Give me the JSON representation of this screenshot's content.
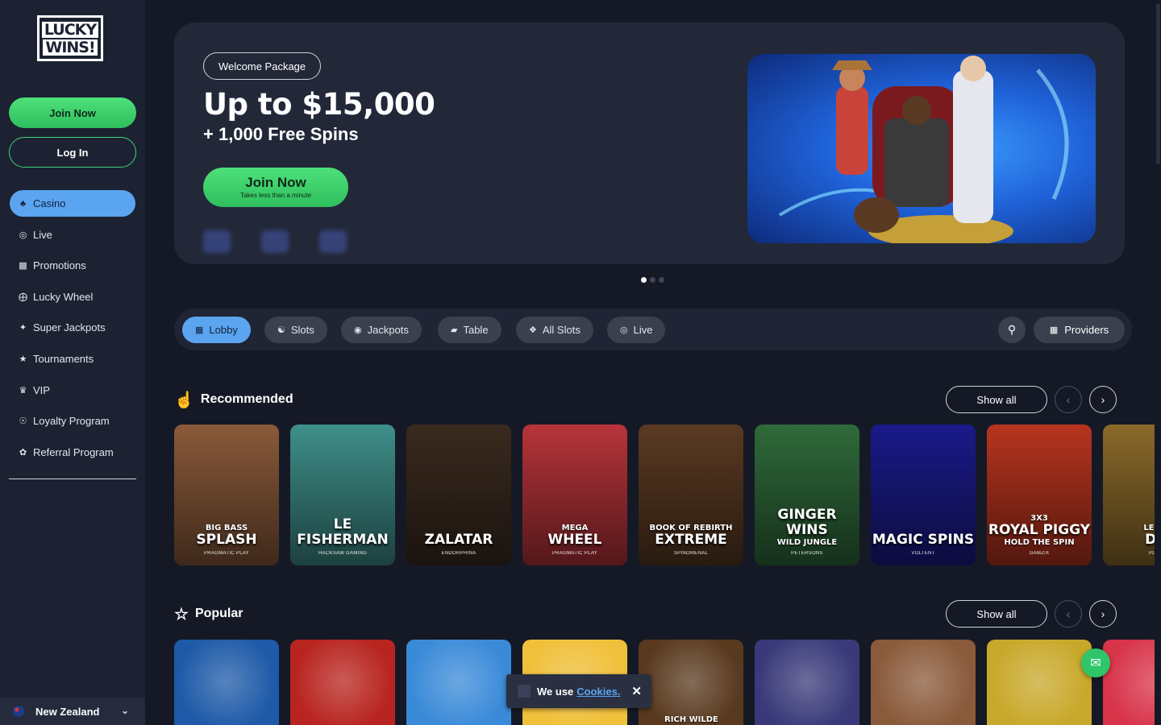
{
  "brand": {
    "line1": "LUCKY",
    "line2": "WINS!"
  },
  "sidebar": {
    "join_label": "Join Now",
    "login_label": "Log In",
    "items": [
      {
        "label": "Casino",
        "icon": "casino-icon"
      },
      {
        "label": "Live",
        "icon": "live-icon"
      },
      {
        "label": "Promotions",
        "icon": "gift-icon"
      },
      {
        "label": "Lucky Wheel",
        "icon": "wheel-icon"
      },
      {
        "label": "Super Jackpots",
        "icon": "jackpot-icon"
      },
      {
        "label": "Tournaments",
        "icon": "trophy-icon"
      },
      {
        "label": "VIP",
        "icon": "crown-icon"
      },
      {
        "label": "Loyalty Program",
        "icon": "loyalty-icon"
      },
      {
        "label": "Referral Program",
        "icon": "referral-icon"
      }
    ],
    "region": "New Zealand"
  },
  "hero": {
    "badge": "Welcome Package",
    "title": "Up to $15,000",
    "subtitle": "+ 1,000 Free Spins",
    "join_label": "Join Now",
    "join_note": "Takes less than a minute",
    "slides": 3,
    "active_slide": 1
  },
  "tabs": [
    {
      "label": "Lobby",
      "icon": "lobby-icon"
    },
    {
      "label": "Slots",
      "icon": "slots-icon"
    },
    {
      "label": "Jackpots",
      "icon": "jackpots-icon"
    },
    {
      "label": "Table",
      "icon": "table-icon"
    },
    {
      "label": "All Slots",
      "icon": "all-slots-icon"
    },
    {
      "label": "Live",
      "icon": "live-icon"
    }
  ],
  "providers_label": "Providers",
  "recommended": {
    "title": "Recommended",
    "show_all": "Show all",
    "games": [
      {
        "sup": "BIG BASS",
        "name": "SPLASH",
        "sub": "",
        "provider": "PRAGMATIC PLAY",
        "color": "#8a5a3a"
      },
      {
        "sup": "",
        "name": "LE FISHERMAN",
        "sub": "",
        "provider": "HACKSAW GAMING",
        "color": "#3f8f8a"
      },
      {
        "sup": "",
        "name": "ZALATAR",
        "sub": "",
        "provider": "ENDORPHINA",
        "color": "#3a2a1f"
      },
      {
        "sup": "MEGA",
        "name": "WHEEL",
        "sub": "",
        "provider": "PRAGMATIC PLAY",
        "color": "#b8343a"
      },
      {
        "sup": "BOOK OF REBIRTH",
        "name": "EXTREME",
        "sub": "",
        "provider": "SPINOMENAL",
        "color": "#5a3a22"
      },
      {
        "sup": "",
        "name": "GINGER WINS",
        "sub": "WILD JUNGLE",
        "provider": "PETERSONS",
        "color": "#2f6a3a"
      },
      {
        "sup": "",
        "name": "MAGIC SPINS",
        "sub": "",
        "provider": "VOLTENT",
        "color": "#1a1a8a"
      },
      {
        "sup": "3X3",
        "name": "ROYAL PIGGY",
        "sub": "HOLD THE SPIN",
        "provider": "GAMZIX",
        "color": "#b8341f"
      },
      {
        "sup": "LEGA",
        "name": "DE",
        "sub": "",
        "provider": "PLAY",
        "color": "#8a6a2a"
      }
    ]
  },
  "popular": {
    "title": "Popular",
    "show_all": "Show all",
    "games": [
      {
        "label": "",
        "color": "#1e5aa8"
      },
      {
        "label": "",
        "color": "#b8241f"
      },
      {
        "label": "",
        "color": "#3a8ad8"
      },
      {
        "label": "",
        "color": "#f0c03a"
      },
      {
        "label": "RICH WILDE",
        "color": "#5a3a1f"
      },
      {
        "label": "",
        "color": "#3a3a7a"
      },
      {
        "label": "",
        "color": "#8a5a3a"
      },
      {
        "label": "",
        "color": "#c8a82a"
      },
      {
        "label": "",
        "color": "#d8344a"
      }
    ]
  },
  "cookie": {
    "text": "We use",
    "link": "Cookies."
  }
}
